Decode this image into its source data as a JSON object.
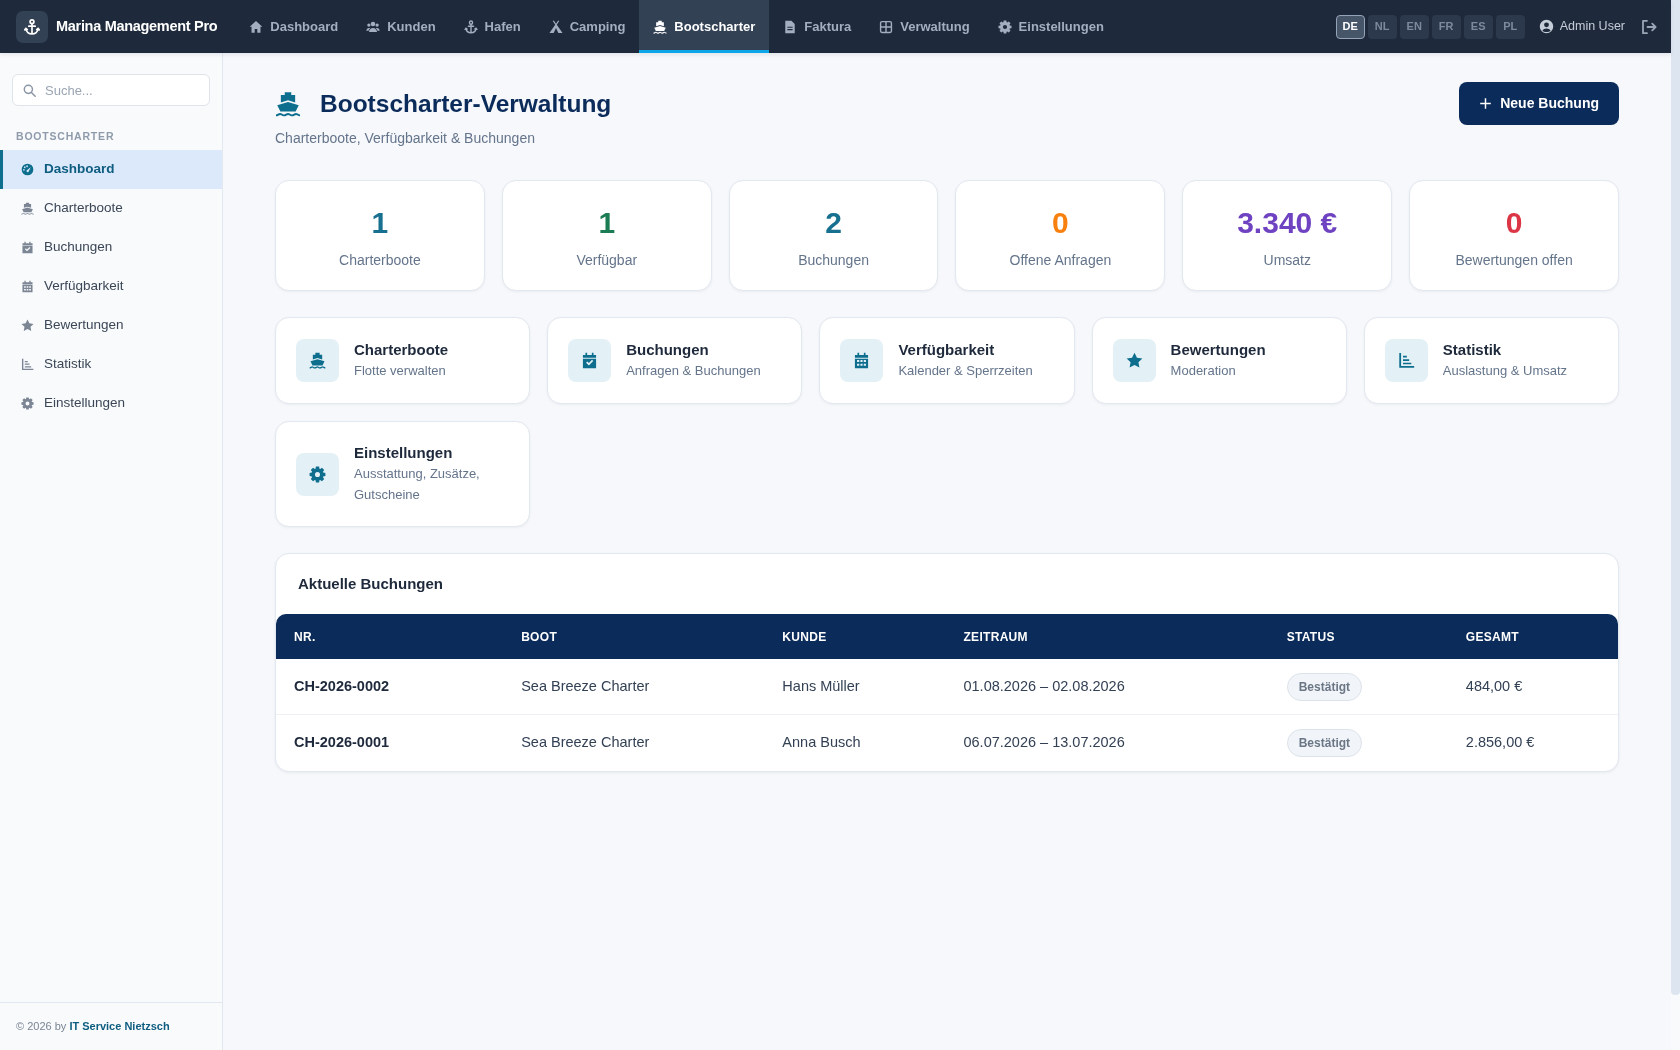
{
  "navbar": {
    "brand": "Marina Management Pro",
    "items": [
      {
        "label": "Dashboard",
        "selected": false
      },
      {
        "label": "Kunden",
        "selected": false
      },
      {
        "label": "Hafen",
        "selected": false
      },
      {
        "label": "Camping",
        "selected": false
      },
      {
        "label": "Bootscharter",
        "selected": true
      },
      {
        "label": "Faktura",
        "selected": false
      },
      {
        "label": "Verwaltung",
        "selected": false
      },
      {
        "label": "Einstellungen",
        "selected": false
      }
    ],
    "languages": [
      {
        "label": "DE",
        "selected": true
      },
      {
        "label": "NL",
        "selected": false
      },
      {
        "label": "EN",
        "selected": false
      },
      {
        "label": "FR",
        "selected": false
      },
      {
        "label": "ES",
        "selected": false
      },
      {
        "label": "PL",
        "selected": false
      }
    ],
    "user": "Admin User"
  },
  "sidebar": {
    "search": {
      "placeholder": "Suche..."
    },
    "section_title": "BOOTSCHARTER",
    "items": [
      {
        "label": "Dashboard",
        "selected": true
      },
      {
        "label": "Charterboote",
        "selected": false
      },
      {
        "label": "Buchungen",
        "selected": false
      },
      {
        "label": "Verfügbarkeit",
        "selected": false
      },
      {
        "label": "Bewertungen",
        "selected": false
      },
      {
        "label": "Statistik",
        "selected": false
      },
      {
        "label": "Einstellungen",
        "selected": false
      }
    ],
    "footer": {
      "text": "© 2026 by",
      "link": "IT Service Nietzsch"
    }
  },
  "header": {
    "title": "Bootscharter-Verwaltung",
    "subtitle": "Charterboote, Verfügbarkeit & Buchungen",
    "button": "Neue Buchung"
  },
  "stats": [
    {
      "value": "1",
      "label": "Charterboote",
      "color": "#17708f"
    },
    {
      "value": "1",
      "label": "Verfügbar",
      "color": "#1c7c54"
    },
    {
      "value": "2",
      "label": "Buchungen",
      "color": "#17708f"
    },
    {
      "value": "0",
      "label": "Offene Anfragen",
      "color": "#f7800f"
    },
    {
      "value": "3.340 €",
      "label": "Umsatz",
      "color": "#6f42c1"
    },
    {
      "value": "0",
      "label": "Bewertungen offen",
      "color": "#dc3545"
    }
  ],
  "shortcuts": [
    {
      "title": "Charterboote",
      "subtitle": "Flotte verwalten"
    },
    {
      "title": "Buchungen",
      "subtitle": "Anfragen & Buchungen"
    },
    {
      "title": "Verfügbarkeit",
      "subtitle": "Kalender & Sperrzeiten"
    },
    {
      "title": "Bewertungen",
      "subtitle": "Moderation"
    },
    {
      "title": "Statistik",
      "subtitle": "Auslastung & Umsatz"
    },
    {
      "title": "Einstellungen",
      "subtitle": "Ausstattung, Zusätze, Gutscheine"
    }
  ],
  "bookings": {
    "title": "Aktuelle Buchungen",
    "columns": [
      {
        "label": "NR.",
        "kind": "id"
      },
      {
        "label": "BOOT",
        "kind": "text"
      },
      {
        "label": "KUNDE",
        "kind": "text"
      },
      {
        "label": "ZEITRAUM",
        "kind": "text"
      },
      {
        "label": "STATUS",
        "kind": "badge"
      },
      {
        "label": "GESAMT",
        "kind": "text"
      }
    ],
    "rows": [
      [
        "CH-2026-0002",
        "Sea Breeze Charter",
        "Hans Müller",
        "01.08.2026 – 02.08.2026",
        "Bestätigt",
        "484,00 €"
      ],
      [
        "CH-2026-0001",
        "Sea Breeze Charter",
        "Anna Busch",
        "06.07.2026 – 13.07.2026",
        "Bestätigt",
        "2.856,00 €"
      ]
    ]
  }
}
